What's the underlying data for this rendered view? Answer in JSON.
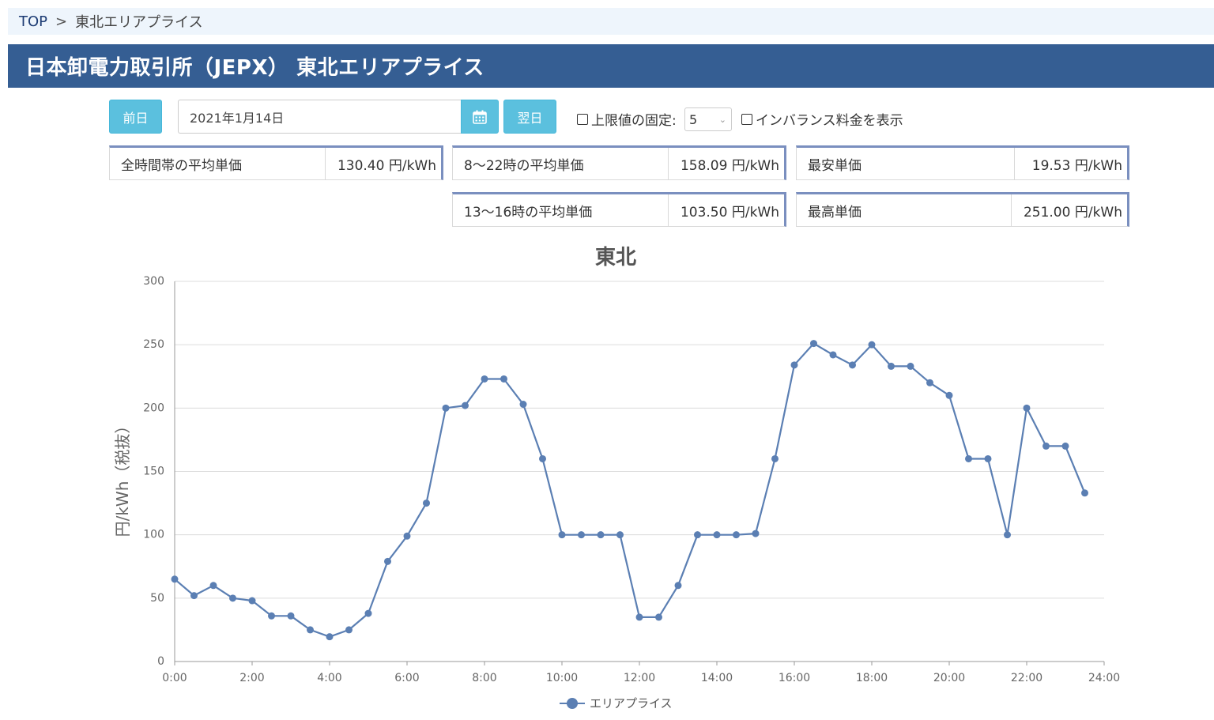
{
  "breadcrumb": {
    "home": "TOP",
    "separator": ">",
    "current": "東北エリアプライス"
  },
  "header": {
    "title": "日本卸電力取引所（JEPX） 東北エリアプライス"
  },
  "controls": {
    "prev_label": "前日",
    "date_value": "2021年1月14日",
    "next_label": "翌日",
    "cap_fix_label": "上限値の固定:",
    "cap_value": "5",
    "imbalance_label": "インバランス料金を表示"
  },
  "stats": {
    "all_avg": {
      "label": "全時間帯の平均単価",
      "value": "130.40 円/kWh"
    },
    "day_avg": {
      "label": "8〜22時の平均単価",
      "value": "158.09 円/kWh"
    },
    "min_price": {
      "label": "最安単価",
      "value": "19.53 円/kWh"
    },
    "peak_avg": {
      "label": "13〜16時の平均単価",
      "value": "103.50 円/kWh"
    },
    "max_price": {
      "label": "最高単価",
      "value": "251.00 円/kWh"
    }
  },
  "chart_data": {
    "type": "line",
    "title": "東北",
    "xlabel": "",
    "ylabel": "円/kWh（税抜）",
    "xlim": [
      0,
      24
    ],
    "ylim": [
      0,
      300
    ],
    "grid": true,
    "legend_position": "bottom",
    "line_color": "#5b7fb3",
    "x_ticks": [
      "0:00",
      "2:00",
      "4:00",
      "6:00",
      "8:00",
      "10:00",
      "12:00",
      "14:00",
      "16:00",
      "18:00",
      "20:00",
      "22:00",
      "24:00"
    ],
    "y_ticks": [
      0,
      50,
      100,
      150,
      200,
      250,
      300
    ],
    "series": [
      {
        "name": "エリアプライス",
        "x": [
          0,
          0.5,
          1,
          1.5,
          2,
          2.5,
          3,
          3.5,
          4,
          4.5,
          5,
          5.5,
          6,
          6.5,
          7,
          7.5,
          8,
          8.5,
          9,
          9.5,
          10,
          10.5,
          11,
          11.5,
          12,
          12.5,
          13,
          13.5,
          14,
          14.5,
          15,
          15.5,
          16,
          16.5,
          17,
          17.5,
          18,
          18.5,
          19,
          19.5,
          20,
          20.5,
          21,
          21.5,
          22,
          22.5,
          23,
          23.5
        ],
        "values": [
          65,
          52,
          60,
          50,
          48,
          36,
          36,
          25,
          19.53,
          25,
          38,
          79,
          99,
          125,
          200,
          202,
          223,
          223,
          203,
          160,
          100,
          100,
          100,
          100,
          35,
          35,
          60,
          100,
          100,
          100,
          101,
          160,
          234,
          251,
          242,
          234,
          250,
          233,
          233,
          220,
          210,
          160,
          160,
          100,
          200,
          170,
          170,
          133
        ]
      }
    ]
  }
}
